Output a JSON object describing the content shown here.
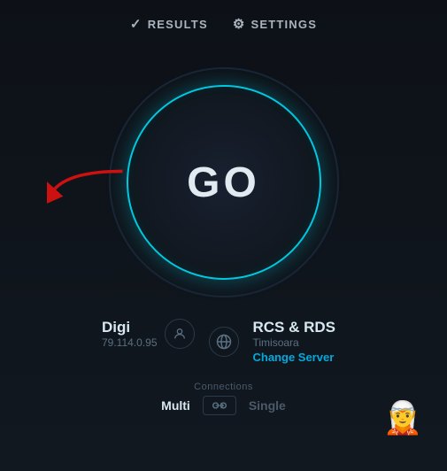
{
  "app": {
    "background": "#0d1117"
  },
  "top_nav": {
    "results_label": "RESULTS",
    "settings_label": "SETTINGS",
    "results_icon": "✓",
    "settings_icon": "⚙"
  },
  "speedtest": {
    "go_label": "GO"
  },
  "left_info": {
    "isp_name": "Digi",
    "ip_address": "79.114.0.95",
    "person_icon": "👤"
  },
  "right_info": {
    "server_name": "RCS & RDS",
    "server_location": "Timisoara",
    "change_server_label": "Change Server",
    "globe_icon": "🌐"
  },
  "connections": {
    "label": "Connections",
    "multi_label": "Multi",
    "single_label": "Single"
  }
}
